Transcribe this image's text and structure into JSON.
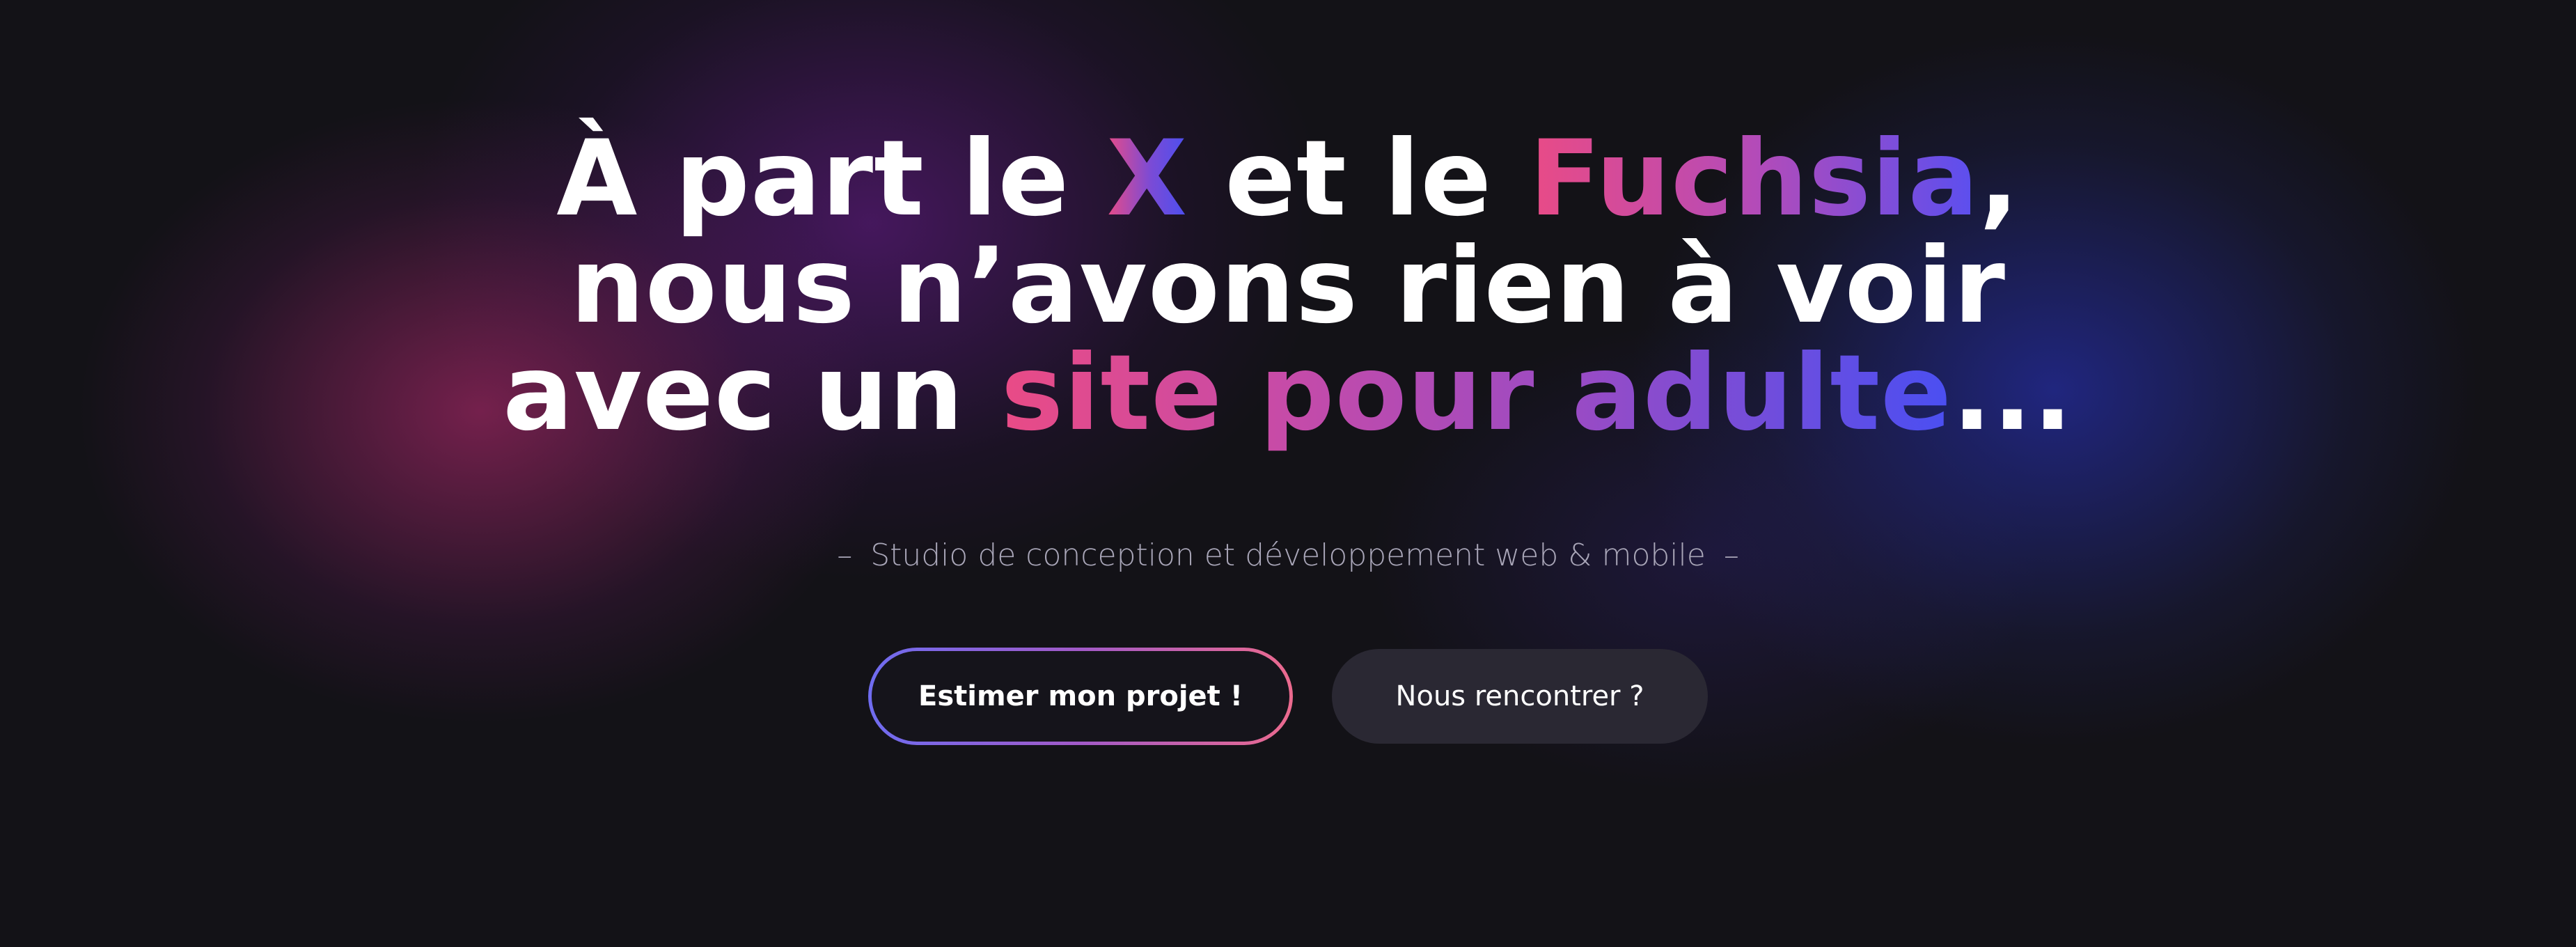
{
  "hero": {
    "headline": {
      "line1": {
        "part1": "À part le ",
        "x": "X",
        "part2": " et le ",
        "fuchsia": "Fuchsia",
        "comma": ","
      },
      "line2": "nous n’avons rien à voir",
      "line3": {
        "part1": "avec un ",
        "site": "site pour adulte",
        "ellipsis": "..."
      }
    },
    "subtitle": {
      "dash_left": "–",
      "text": "Studio de conception et développement web & mobile",
      "dash_right": "–"
    },
    "buttons": {
      "primary_label": "Estimer mon projet !",
      "secondary_label": "Nous rencontrer ?"
    },
    "colors": {
      "background": "#131217",
      "gradient_pink": "#e94b86",
      "gradient_purple": "#9a4bc4",
      "gradient_blue": "#4a4ff0",
      "secondary_button": "#2a2833",
      "subtitle_text": "#a9a6b8"
    }
  }
}
